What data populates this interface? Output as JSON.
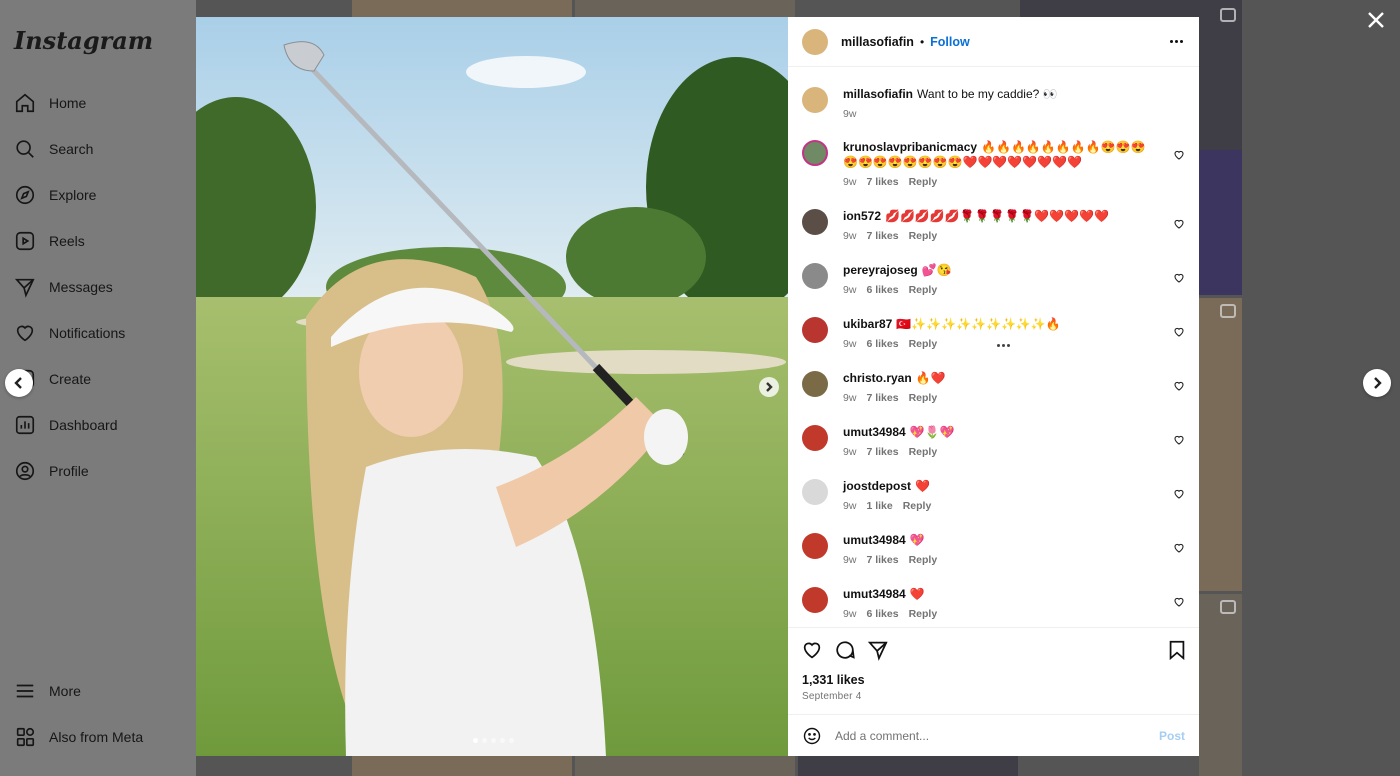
{
  "sidebar": {
    "logo": "Instagram",
    "items": [
      {
        "label": "Home",
        "icon": "home-icon"
      },
      {
        "label": "Search",
        "icon": "search-icon"
      },
      {
        "label": "Explore",
        "icon": "explore-icon"
      },
      {
        "label": "Reels",
        "icon": "reels-icon"
      },
      {
        "label": "Messages",
        "icon": "messages-icon"
      },
      {
        "label": "Notifications",
        "icon": "heart-icon"
      },
      {
        "label": "Create",
        "icon": "create-icon"
      },
      {
        "label": "Dashboard",
        "icon": "dashboard-icon"
      },
      {
        "label": "Profile",
        "icon": "profile-icon"
      }
    ],
    "bottom_items": [
      {
        "label": "More",
        "icon": "menu-icon"
      },
      {
        "label": "Also from Meta",
        "icon": "meta-icon"
      }
    ]
  },
  "post": {
    "username": "millasofiafin",
    "separator": "•",
    "follow_label": "Follow",
    "caption": {
      "username": "millasofiafin",
      "text": "Want to be my caddie? 👀",
      "time": "9w"
    },
    "image_dots": 5,
    "active_dot": 0,
    "likes": "1,331 likes",
    "date": "September 4"
  },
  "comments": [
    {
      "username": "krunoslavpribanicmacy",
      "text": "🔥🔥🔥🔥🔥🔥🔥🔥😍😍😍😍😍😍😍😍😍😍😍❤️❤️❤️❤️❤️❤️❤️❤️",
      "time": "9w",
      "likes": "7 likes",
      "reply": "Reply",
      "avatar_color": "#6f8a64"
    },
    {
      "username": "ion572",
      "text": "💋💋💋💋💋🌹🌹🌹🌹🌹❤️❤️❤️❤️❤️",
      "time": "9w",
      "likes": "7 likes",
      "reply": "Reply",
      "avatar_color": "#5a4e46"
    },
    {
      "username": "pereyrajoseg",
      "text": "💕😘",
      "time": "9w",
      "likes": "6 likes",
      "reply": "Reply",
      "avatar_color": "#8a8a8a"
    },
    {
      "username": "ukibar87",
      "text": "🇹🇷✨✨✨✨✨✨✨✨✨🔥",
      "time": "9w",
      "likes": "6 likes",
      "reply": "Reply",
      "avatar_color": "#b8362f"
    },
    {
      "username": "christo.ryan",
      "text": "🔥❤️",
      "time": "9w",
      "likes": "7 likes",
      "reply": "Reply",
      "avatar_color": "#7a6a45"
    },
    {
      "username": "umut34984",
      "text": "💖🌷💖",
      "time": "9w",
      "likes": "7 likes",
      "reply": "Reply",
      "avatar_color": "#c0392b"
    },
    {
      "username": "joostdepost",
      "text": "❤️",
      "time": "9w",
      "likes": "1 like",
      "reply": "Reply",
      "avatar_color": "#d9d9d9"
    },
    {
      "username": "umut34984",
      "text": "💖",
      "time": "9w",
      "likes": "7 likes",
      "reply": "Reply",
      "avatar_color": "#c0392b"
    },
    {
      "username": "umut34984",
      "text": "❤️",
      "time": "9w",
      "likes": "6 likes",
      "reply": "Reply",
      "avatar_color": "#c0392b"
    }
  ],
  "add_comment": {
    "placeholder": "Add a comment...",
    "post_label": "Post"
  }
}
